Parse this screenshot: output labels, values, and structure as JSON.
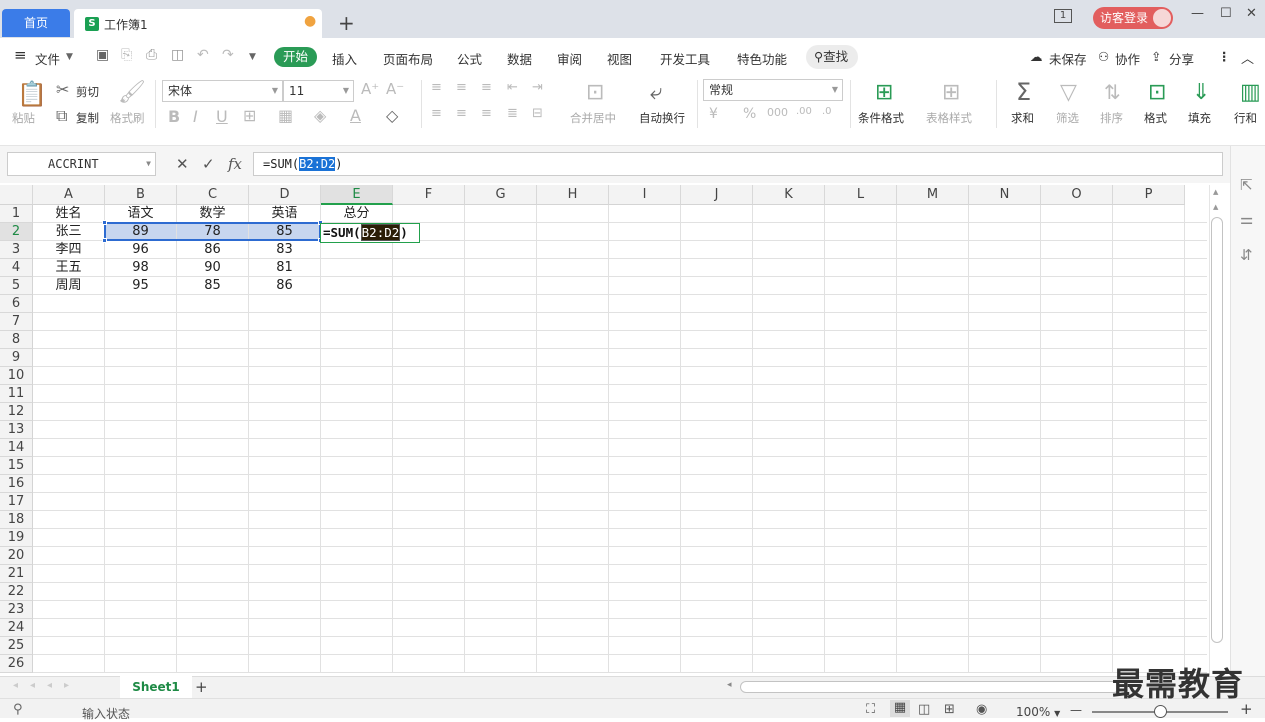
{
  "titlebar": {
    "home_tab": "首页",
    "workbook_tab": "工作簿1",
    "workbook_logo": "S",
    "unsaved_dot": "●",
    "add_tab": "+",
    "login_btn": "访客登录",
    "window_icons": [
      "1",
      "—",
      "☐",
      "✕"
    ]
  },
  "menubar": {
    "file": "文件",
    "start": "开始",
    "items": [
      "插入",
      "页面布局",
      "公式",
      "数据",
      "审阅",
      "视图",
      "开发工具",
      "特色功能"
    ],
    "find": "查找",
    "unsaved": "未保存",
    "collab": "协作",
    "share": "分享"
  },
  "ribbon": {
    "paste": "粘贴",
    "cut": "剪切",
    "copy": "复制",
    "format_painter": "格式刷",
    "font_name": "宋体",
    "font_size": "11",
    "merge_center": "合并居中",
    "wrap_text": "自动换行",
    "number_format": "常规",
    "conditional_format": "条件格式",
    "table_style": "表格样式",
    "sum": "求和",
    "filter": "筛选",
    "sort": "排序",
    "format": "格式",
    "fill": "填充",
    "rows_cols": "行和"
  },
  "formula_bar": {
    "name_box": "ACCRINT",
    "formula_prefix": "=SUM(",
    "formula_ref": "B2:D2",
    "formula_suffix": ")",
    "fx": "fx"
  },
  "sheet": {
    "columns": [
      "A",
      "B",
      "C",
      "D",
      "E",
      "F",
      "G",
      "H",
      "I",
      "J",
      "K",
      "L",
      "M",
      "N",
      "O",
      "P"
    ],
    "rows": [
      "1",
      "2",
      "3",
      "4",
      "5",
      "6",
      "7",
      "8",
      "9",
      "10",
      "11",
      "12",
      "13",
      "14",
      "15",
      "16",
      "17",
      "18",
      "19",
      "20",
      "21",
      "22",
      "23",
      "24",
      "25",
      "26"
    ],
    "data": [
      [
        "姓名",
        "语文",
        "数学",
        "英语",
        "总分"
      ],
      [
        "张三",
        "89",
        "78",
        "85",
        ""
      ],
      [
        "李四",
        "96",
        "86",
        "83",
        ""
      ],
      [
        "王五",
        "98",
        "90",
        "81",
        ""
      ],
      [
        "周周",
        "95",
        "85",
        "86",
        ""
      ]
    ],
    "edit_prefix": "=SUM(",
    "edit_ref": "B2:D2",
    "edit_suffix": ")"
  },
  "sheet_tabs": {
    "active": "Sheet1",
    "add": "+"
  },
  "status": {
    "mode": "输入状态",
    "zoom": "100%",
    "zoom_minus": "—",
    "zoom_plus": "+"
  },
  "watermark": "最需教育"
}
